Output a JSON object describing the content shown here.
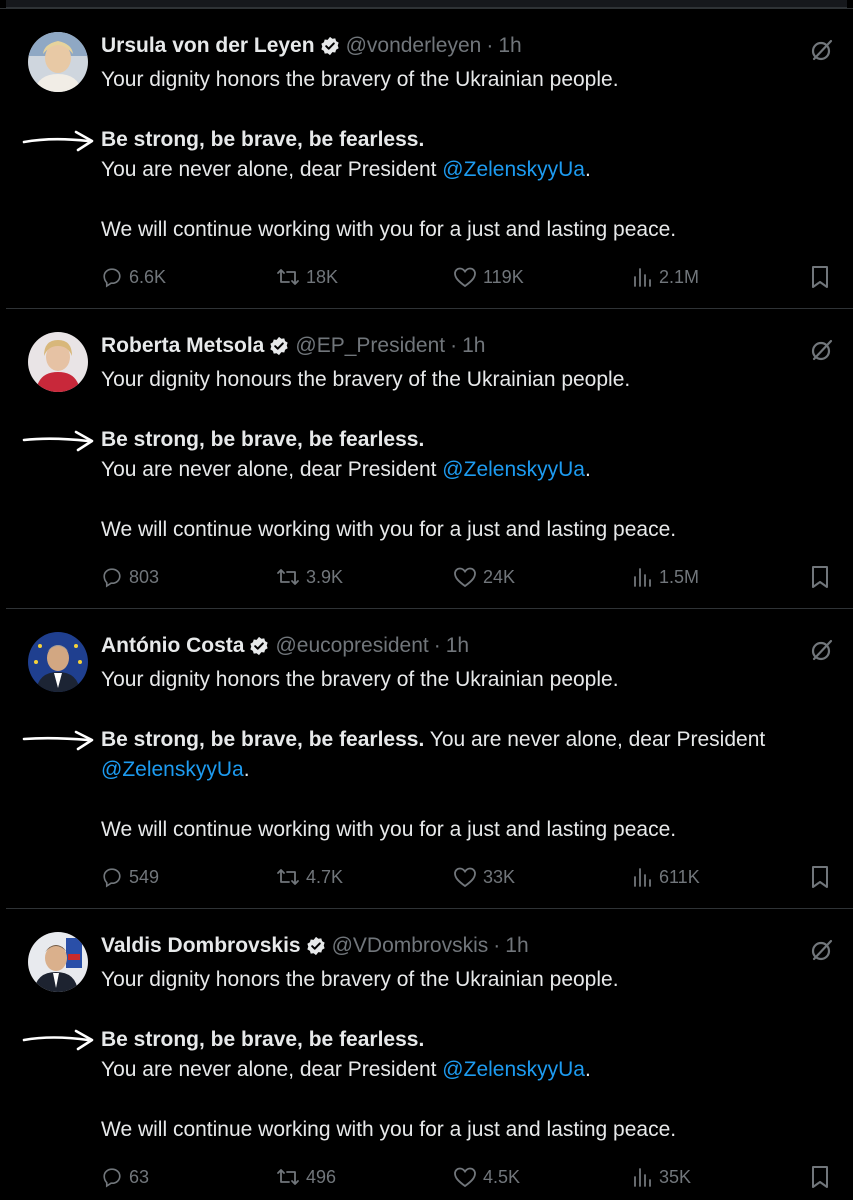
{
  "tweets": [
    {
      "name": "Ursula von der Leyen",
      "handle": "@vonderleyen",
      "time": "1h",
      "line1": "Your dignity honors the bravery of the Ukrainian people.",
      "bold": "Be strong, be brave, be fearless.",
      "line2_pre": "You are never alone, dear President ",
      "mention": "@ZelenskyyUa",
      "line2_post": ".",
      "line3": "We will continue working with you for a just and lasting peace.",
      "replies": "6.6K",
      "reposts": "18K",
      "likes": "119K",
      "views": "2.1M"
    },
    {
      "name": "Roberta Metsola",
      "handle": "@EP_President",
      "time": "1h",
      "line1": "Your dignity honours the bravery of the Ukrainian people.",
      "bold": "Be strong, be brave, be fearless.",
      "line2_pre": "You are never alone, dear President ",
      "mention": "@ZelenskyyUa",
      "line2_post": ".",
      "line3": "We will continue working with you for a just and lasting peace.",
      "replies": "803",
      "reposts": "3.9K",
      "likes": "24K",
      "views": "1.5M"
    },
    {
      "name": "António Costa",
      "handle": "@eucopresident",
      "time": "1h",
      "line1": "Your dignity honors the bravery of the Ukrainian people.",
      "bold": "Be strong, be brave, be fearless.",
      "inline_after_bold": " You are never alone, dear President",
      "mention": "@ZelenskyyUa",
      "line2_post": ".",
      "line3": "We will continue working with you for a just and lasting peace.",
      "replies": "549",
      "reposts": "4.7K",
      "likes": "33K",
      "views": "611K"
    },
    {
      "name": "Valdis Dombrovskis",
      "handle": "@VDombrovskis",
      "time": "1h",
      "line1": "Your dignity honors the bravery of the Ukrainian people.",
      "bold": "Be strong, be brave, be fearless.",
      "line2_pre": "You are never alone, dear President ",
      "mention": "@ZelenskyyUa",
      "line2_post": ".",
      "line3": "We will continue working with you for a just and lasting peace.",
      "replies": "63",
      "reposts": "496",
      "likes": "4.5K",
      "views": "35K"
    }
  ],
  "separator": "·",
  "icons": {
    "verified": "verified-badge-icon",
    "grok": "grok-icon",
    "reply": "reply-icon",
    "repost": "repost-icon",
    "like": "heart-icon",
    "views": "views-icon",
    "bookmark": "bookmark-icon",
    "arrow": "hand-drawn-arrow-icon"
  },
  "colors": {
    "background": "#000000",
    "text": "#e7e9ea",
    "muted": "#71767b",
    "mention": "#1d9bf0",
    "divider": "#2f3336"
  }
}
